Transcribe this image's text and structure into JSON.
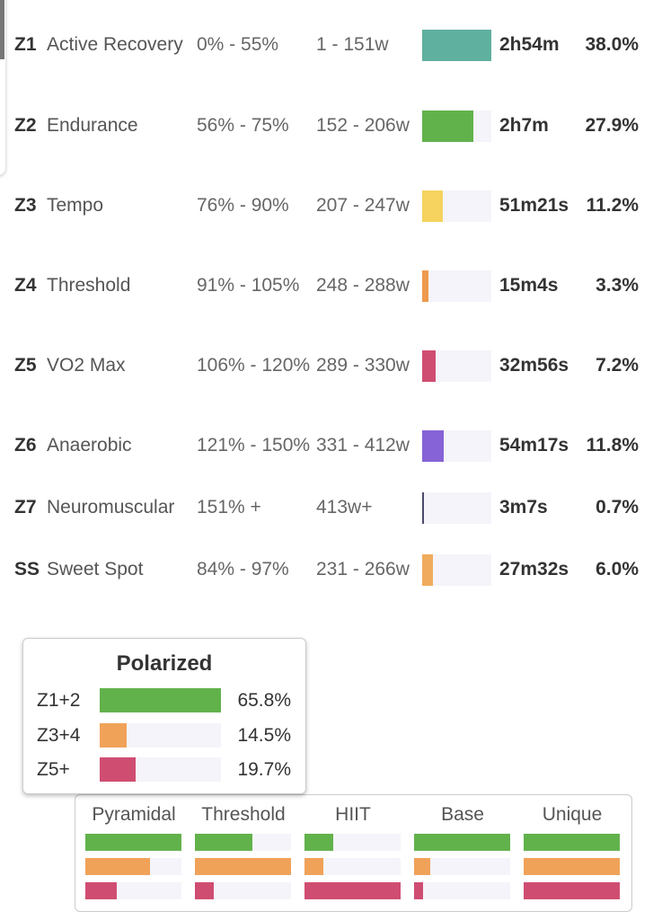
{
  "colors": {
    "z1": "#5fb09f",
    "z2": "#62b24c",
    "z3": "#f5d35e",
    "z4": "#ee9a4f",
    "z5": "#d04d72",
    "z6": "#8663d6",
    "z7": "#4a4a6a",
    "ss": "#f0ac5c",
    "track": "#f4f4fa"
  },
  "zones": [
    {
      "code": "Z1",
      "name": "Active Recovery",
      "pct": "0% - 55%",
      "watts": "1 - 151w",
      "time": "2h54m",
      "percent": "38.0%",
      "value": 38.0,
      "color": "#5fb09f"
    },
    {
      "code": "Z2",
      "name": "Endurance",
      "pct": "56% - 75%",
      "watts": "152 - 206w",
      "time": "2h7m",
      "percent": "27.9%",
      "value": 27.9,
      "color": "#62b24c"
    },
    {
      "code": "Z3",
      "name": "Tempo",
      "pct": "76% - 90%",
      "watts": "207 - 247w",
      "time": "51m21s",
      "percent": "11.2%",
      "value": 11.2,
      "color": "#f5d35e"
    },
    {
      "code": "Z4",
      "name": "Threshold",
      "pct": "91% - 105%",
      "watts": "248 - 288w",
      "time": "15m4s",
      "percent": "3.3%",
      "value": 3.3,
      "color": "#ee9a4f"
    },
    {
      "code": "Z5",
      "name": "VO2 Max",
      "pct": "106% - 120%",
      "watts": "289 - 330w",
      "time": "32m56s",
      "percent": "7.2%",
      "value": 7.2,
      "color": "#d04d72"
    },
    {
      "code": "Z6",
      "name": "Anaerobic",
      "pct": "121% - 150%",
      "watts": "331 - 412w",
      "time": "54m17s",
      "percent": "11.8%",
      "value": 11.8,
      "color": "#8663d6"
    },
    {
      "code": "Z7",
      "name": "Neuromuscular",
      "pct": "151% +",
      "watts": "413w+",
      "time": "3m7s",
      "percent": "0.7%",
      "value": 0.7,
      "color": "#4a4a6a"
    },
    {
      "code": "SS",
      "name": "Sweet Spot",
      "pct": "84% - 97%",
      "watts": "231 - 266w",
      "time": "27m32s",
      "percent": "6.0%",
      "value": 6.0,
      "color": "#f0ac5c"
    }
  ],
  "polarized": {
    "title": "Polarized",
    "rows": [
      {
        "label": "Z1+2",
        "percent": "65.8%",
        "value": 65.8,
        "color": "#62b24c"
      },
      {
        "label": "Z3+4",
        "percent": "14.5%",
        "value": 14.5,
        "color": "#f0a259"
      },
      {
        "label": "Z5+",
        "percent": "19.7%",
        "value": 19.7,
        "color": "#d04d72"
      }
    ]
  },
  "models": [
    {
      "label": "Pyramidal",
      "fills": [
        1,
        0.67,
        0.33
      ]
    },
    {
      "label": "Threshold",
      "fills": [
        0.6,
        1,
        0.2
      ]
    },
    {
      "label": "HIIT",
      "fills": [
        0.3,
        0.2,
        1
      ]
    },
    {
      "label": "Base",
      "fills": [
        1,
        0.17,
        0.09
      ]
    },
    {
      "label": "Unique",
      "fills": [
        1,
        1,
        1
      ]
    }
  ],
  "model_colors": [
    "#62b24c",
    "#f0a259",
    "#d04d72"
  ]
}
